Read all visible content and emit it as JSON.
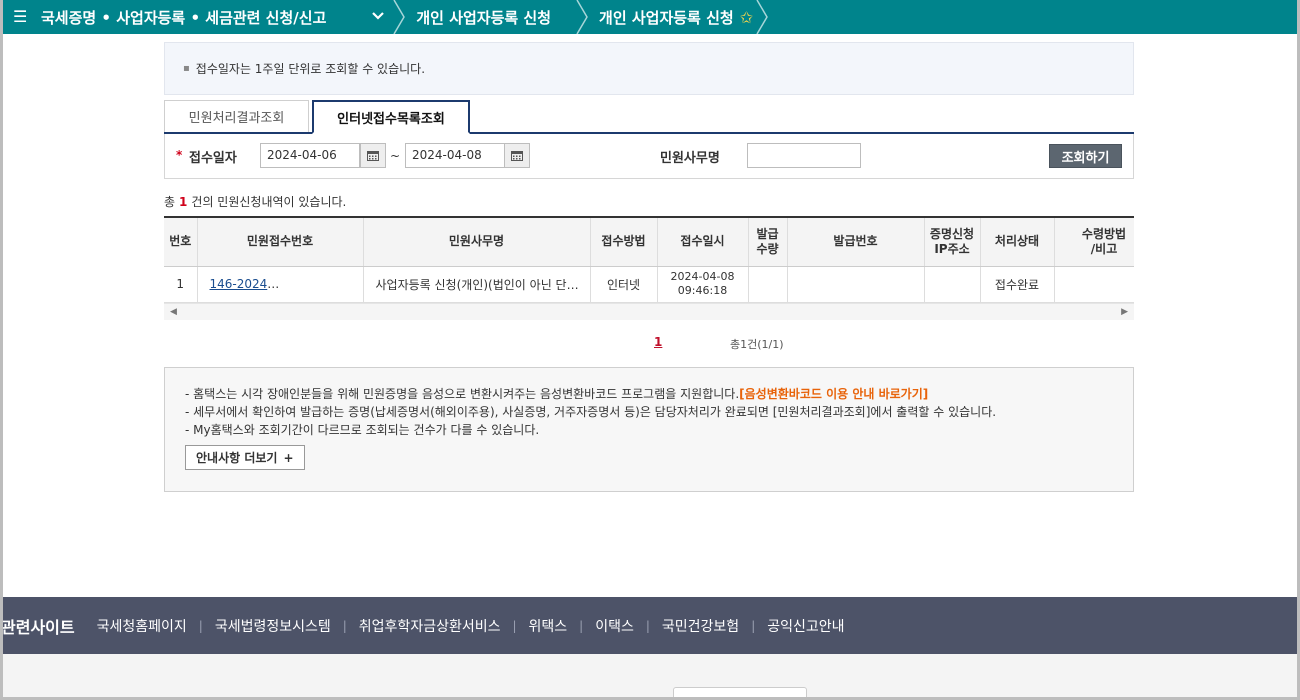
{
  "nav": {
    "category": "국세증명 • 사업자등록 • 세금관련 신청/신고",
    "item1": "개인 사업자등록 신청",
    "item2": "개인 사업자등록 신청"
  },
  "notice": {
    "text": "접수일자는 1주일 단위로 조회할 수 있습니다."
  },
  "tabs": [
    {
      "label": "민원처리결과조회",
      "active": false
    },
    {
      "label": "인터넷접수목록조회",
      "active": true
    }
  ],
  "search": {
    "date_label": "접수일자",
    "date_from": "2024-04-06",
    "date_to": "2024-04-08",
    "separator": "~",
    "service_label": "민원사무명",
    "service_value": "",
    "button": "조회하기"
  },
  "count": {
    "prefix": "총",
    "value": "1",
    "suffix": "건의 민원신청내역이 있습니다."
  },
  "table": {
    "headers": [
      "번호",
      "민원접수번호",
      "민원사무명",
      "접수방법",
      "접수일시",
      "발급수량",
      "발급번호",
      "증명신청IP주소",
      "처리상태",
      "수령방법/비고"
    ],
    "header_lines": [
      [
        "번호"
      ],
      [
        "민원접수번호"
      ],
      [
        "민원사무명"
      ],
      [
        "접수방법"
      ],
      [
        "접수일시"
      ],
      [
        "발급",
        "수량"
      ],
      [
        "발급번호"
      ],
      [
        "증명신청",
        "IP주소"
      ],
      [
        "처리상태"
      ],
      [
        "수령방법",
        "/비고"
      ]
    ],
    "rows": [
      {
        "no": "1",
        "receipt_no": "146-2024",
        "service": "사업자등록 신청(개인)(법인이 아닌 단체의 고유번호신청포함)",
        "method": "인터넷",
        "date": "2024-04-08",
        "time": "09:46:18",
        "qty": "",
        "issue_no": "",
        "ip": "",
        "status": "접수완료",
        "note": ""
      }
    ]
  },
  "pagination": {
    "current": "1",
    "summary": "총1건(1/1)"
  },
  "guide": {
    "line1": "- 홈택스는 시각 장애인분들을 위해 민원증명을 음성으로 변환시켜주는 음성변환바코드 프로그램을 지원합니다.",
    "line1_link": "[음성변환바코드 이용 안내 바로가기]",
    "line2": "- 세무서에서 확인하여 발급하는 증명(납세증명서(해외이주용), 사실증명, 거주자증명서 등)은 담당자처리가 완료되면 [민원처리결과조회]에서 출력할 수 있습니다.",
    "line3": "- My홈택스와 조회기간이 다르므로 조회되는 건수가 다를 수 있습니다.",
    "more_button": "안내사항 더보기"
  },
  "footer": {
    "title": "관련사이트",
    "links": [
      "국세청홈페이지",
      "국세법령정보시스템",
      "취업후학자금상환서비스",
      "위택스",
      "이택스",
      "국민건강보험",
      "공익신고안내"
    ]
  },
  "colors": {
    "nav_bg": "#00848c",
    "footer_bg": "#4d5368",
    "accent_red": "#d0021b",
    "accent_orange": "#e8630a",
    "button_gray": "#5c6670"
  }
}
